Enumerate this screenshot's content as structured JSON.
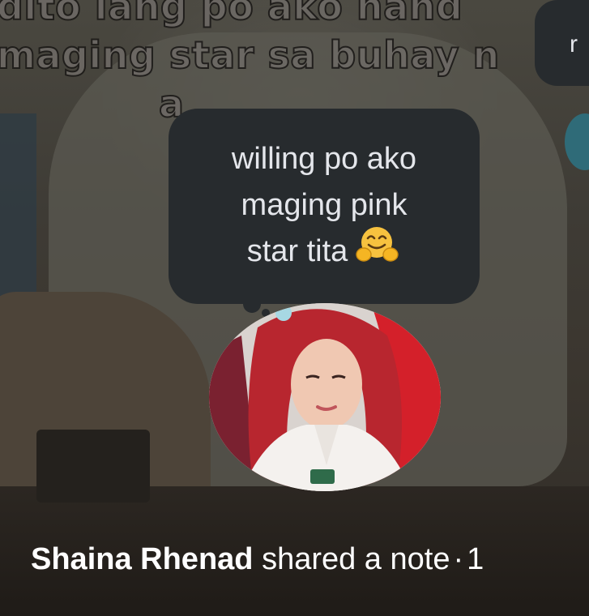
{
  "background_caption": {
    "line1": "dito lang po ako hand",
    "line2": "maging star sa buhay n",
    "line3": "a"
  },
  "side_bubble": {
    "text": "r"
  },
  "note": {
    "line1": "willing po ako",
    "line2": "maging pink",
    "line3": "star tita",
    "emoji": "hugging-face-emoji"
  },
  "byline": {
    "author": "Shaina Rhenad",
    "action": "shared a note",
    "separator": "·",
    "time": "1"
  },
  "colors": {
    "bubble": "#272b2e",
    "bubble_text": "#e4e6eb",
    "byline_text": "#ffffff",
    "emoji": "#f7c23f"
  }
}
